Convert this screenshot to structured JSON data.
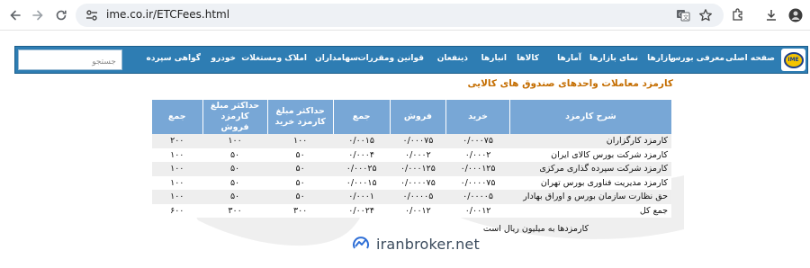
{
  "browser": {
    "url": "ime.co.ir/ETCFees.html"
  },
  "menu": {
    "items": [
      "صفحه اصلی",
      "معرفی بورس",
      "بازارها",
      "نمای بازارها",
      "آمارها",
      "کالاها",
      "انبارها",
      "ذینفعان",
      "قوانین ومقررات",
      "سهامداران",
      "املاک ومستغلات",
      "خودرو",
      "گواهی سپرده"
    ],
    "search_placeholder": "جستجو",
    "logo_text": "IME"
  },
  "section_title": "کارمزد معاملات واحدهای صندوق های کالایی",
  "table": {
    "headers": [
      "شرح کارمزد",
      "خرید",
      "فروش",
      "جمع",
      "حداکثر مبلغ کارمزد خرید",
      "حداکثر مبلغ کارمزد فروش",
      "جمع"
    ],
    "rows": [
      [
        "کارمزد کارگزاران",
        "۰/۰۰۰۷۵",
        "۰/۰۰۰۷۵",
        "۰/۰۰۱۵",
        "۱۰۰",
        "۱۰۰",
        "۲۰۰"
      ],
      [
        "کارمزد شرکت بورس کالای ایران",
        "۰/۰۰۰۲",
        "۰/۰۰۰۲",
        "۰/۰۰۰۴",
        "۵۰",
        "۵۰",
        "۱۰۰"
      ],
      [
        "کارمزد شرکت سپرده گذاری مرکزی",
        "۰/۰۰۰۱۲۵",
        "۰/۰۰۰۱۲۵",
        "۰/۰۰۰۲۵",
        "۵۰",
        "۵۰",
        "۱۰۰"
      ],
      [
        "کارمزد مدیریت فناوری بورس تهران",
        "۰/۰۰۰۰۷۵",
        "۰/۰۰۰۰۷۵",
        "۰/۰۰۰۱۵",
        "۵۰",
        "۵۰",
        "۱۰۰"
      ],
      [
        "حق نظارت سازمان بورس و اوراق بهادار",
        "۰/۰۰۰۰۵",
        "۰/۰۰۰۰۵",
        "۰/۰۰۰۱",
        "۵۰",
        "۵۰",
        "۱۰۰"
      ],
      [
        "جمع کل",
        "۰/۰۰۱۲",
        "۰/۰۰۱۲",
        "۰/۰۰۲۴",
        "۳۰۰",
        "۳۰۰",
        "۶۰۰"
      ]
    ]
  },
  "note": "کارمزدها به میلیون ریال است",
  "watermark": "iranbroker.net",
  "colors": {
    "menu_bg": "#2e7db3",
    "header_bg": "#78a7d6",
    "title": "#c46d00"
  }
}
